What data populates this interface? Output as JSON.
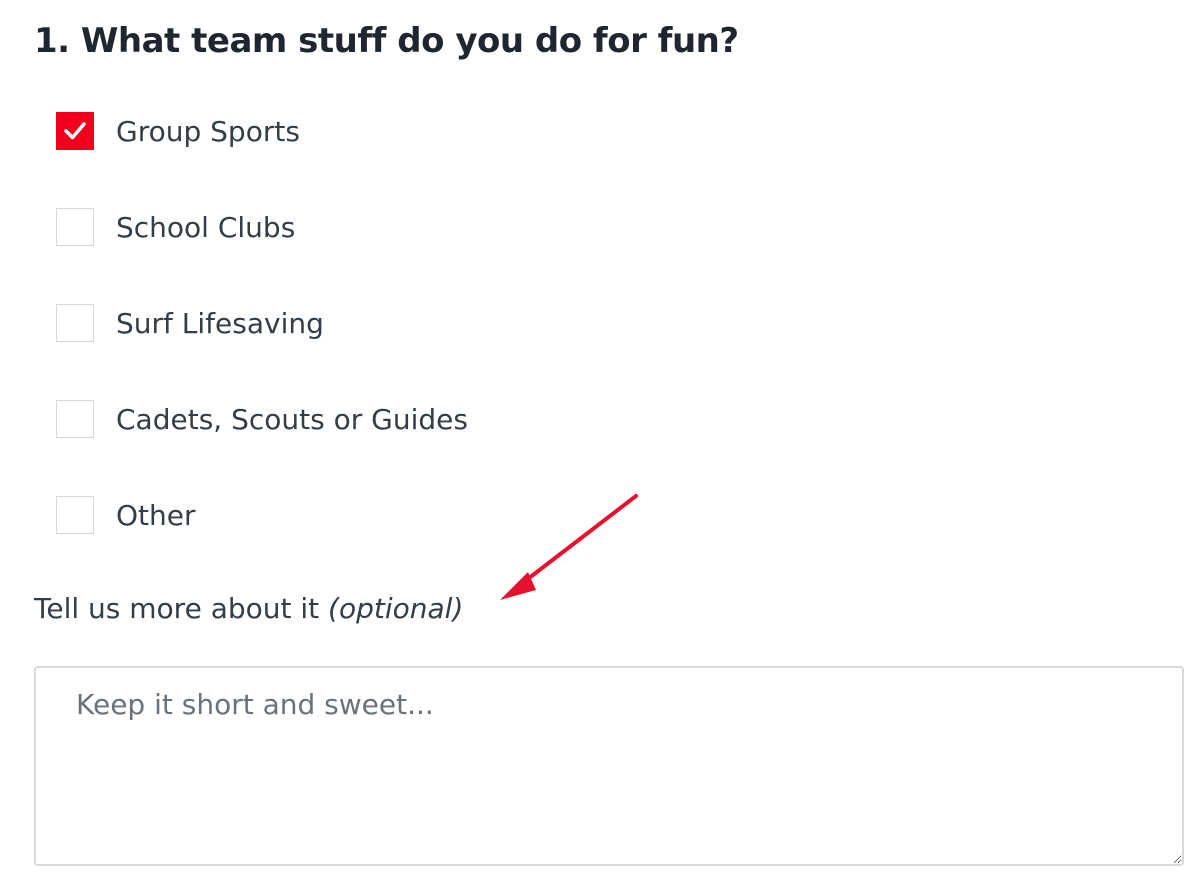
{
  "question": {
    "title": "1. What team stuff do you do for fun?"
  },
  "options": [
    {
      "label": "Group Sports",
      "checked": true
    },
    {
      "label": "School Clubs",
      "checked": false
    },
    {
      "label": "Surf Lifesaving",
      "checked": false
    },
    {
      "label": "Cadets, Scouts or Guides",
      "checked": false
    },
    {
      "label": "Other",
      "checked": false
    }
  ],
  "comment": {
    "label": "Tell us more about it",
    "optional_text": "(optional)",
    "placeholder": "Keep it short and sweet...",
    "value": ""
  },
  "colors": {
    "accent": "#f0001c",
    "annotation_arrow": "#e8112d"
  },
  "icons": {
    "checkmark": "checkmark-icon",
    "arrow": "annotation-arrow"
  }
}
